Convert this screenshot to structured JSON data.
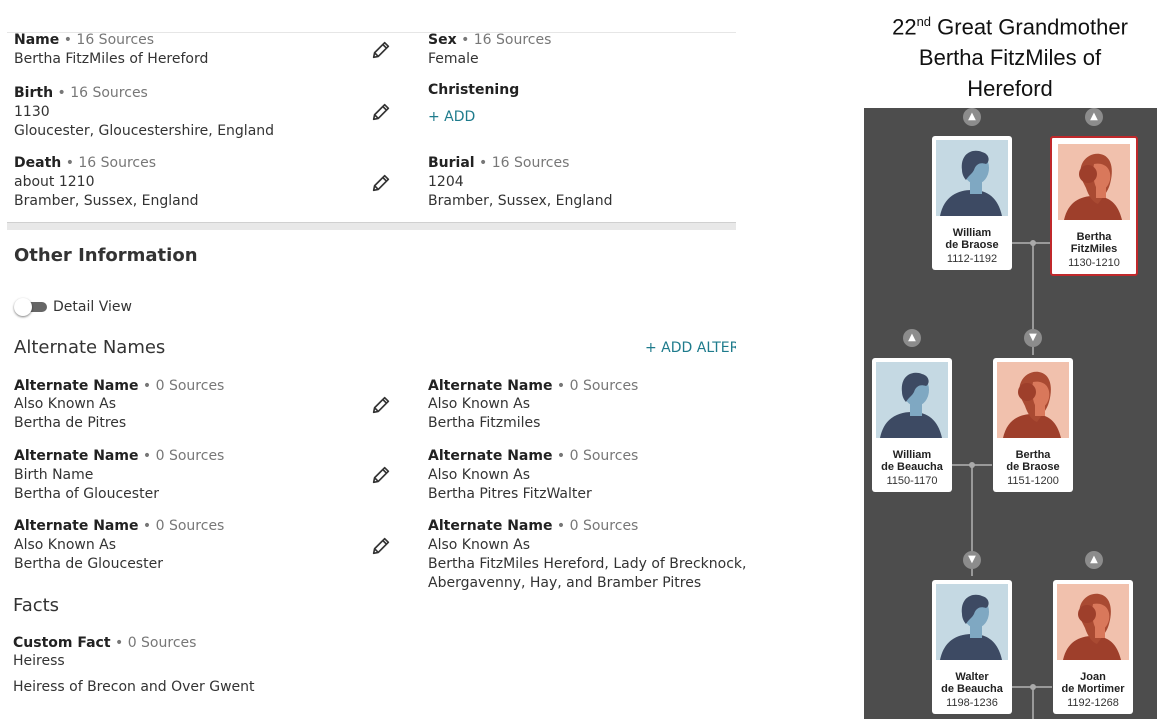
{
  "vitals": {
    "name": {
      "label": "Name",
      "sources": "• 16 Sources",
      "value": "Bertha FitzMiles of Hereford"
    },
    "sex": {
      "label": "Sex",
      "sources": "• 16 Sources",
      "value": "Female"
    },
    "birth": {
      "label": "Birth",
      "sources": "• 16 Sources",
      "line1": "1130",
      "line2": "Gloucester, Gloucestershire, England"
    },
    "christening": {
      "label": "Christening",
      "add": "+  ADD"
    },
    "death": {
      "label": "Death",
      "sources": "• 16 Sources",
      "line1": "about 1210",
      "line2": "Bramber, Sussex, England"
    },
    "burial": {
      "label": "Burial",
      "sources": "• 16 Sources",
      "line1": "1204",
      "line2": "Bramber, Sussex, England"
    }
  },
  "other": {
    "heading": "Other Information",
    "detail_view": "Detail View",
    "alt_heading": "Alternate Names",
    "add_alt": "+  ADD ALTER",
    "alt_names": [
      {
        "label": "Alternate Name",
        "sources": "• 0 Sources",
        "type": "Also Known As",
        "value": "Bertha de Pitres"
      },
      {
        "label": "Alternate Name",
        "sources": "• 0 Sources",
        "type": "Also Known As",
        "value": "Bertha Fitzmiles"
      },
      {
        "label": "Alternate Name",
        "sources": "• 0 Sources",
        "type": "Birth Name",
        "value": "Bertha of Gloucester"
      },
      {
        "label": "Alternate Name",
        "sources": "• 0 Sources",
        "type": "Also Known As",
        "value": "Bertha Pitres FitzWalter"
      },
      {
        "label": "Alternate Name",
        "sources": "• 0 Sources",
        "type": "Also Known As",
        "value": "Bertha de Gloucester"
      },
      {
        "label": "Alternate Name",
        "sources": "• 0 Sources",
        "type": "Also Known As",
        "value": "Bertha FitzMiles Hereford, Lady of Brecknock,",
        "value2": "Abergavenny, Hay, and Bramber Pitres"
      }
    ],
    "facts_heading": "Facts",
    "fact": {
      "label": "Custom Fact",
      "sources": "• 0 Sources",
      "value": "Heiress",
      "desc": "Heiress of Brecon and Over Gwent"
    }
  },
  "title": {
    "pre": "22",
    "sup": "nd",
    "post": " Great Grandmother",
    "line2": "Bertha FitzMiles of",
    "line3": "Hereford"
  },
  "tree": {
    "people": [
      {
        "n1": "William",
        "n2": "de Braose",
        "dates": "1112-1192",
        "sex": "male"
      },
      {
        "n1": "Bertha",
        "n2": "FitzMiles",
        "dates": "1130-1210",
        "sex": "female"
      },
      {
        "n1": "William",
        "n2": "de Beaucha",
        "dates": "1150-1170",
        "sex": "male"
      },
      {
        "n1": "Bertha",
        "n2": "de Braose",
        "dates": "1151-1200",
        "sex": "female"
      },
      {
        "n1": "Walter",
        "n2": "de Beaucha",
        "dates": "1198-1236",
        "sex": "male"
      },
      {
        "n1": "Joan",
        "n2": "de Mortimer",
        "dates": "1192-1268",
        "sex": "female"
      }
    ],
    "colors": {
      "male_bg": "#c5d9e3",
      "male_body": "#3d4a63",
      "male_face": "#7fa8c2",
      "female_bg": "#f1c1ad",
      "female_body": "#9e3f2b",
      "female_hair": "#a94a32",
      "female_face": "#d9785b",
      "selected": "#c0282b"
    },
    "chevron_up_icon": "chevron-up-icon",
    "chevron_down_icon": "chevron-down-icon"
  }
}
